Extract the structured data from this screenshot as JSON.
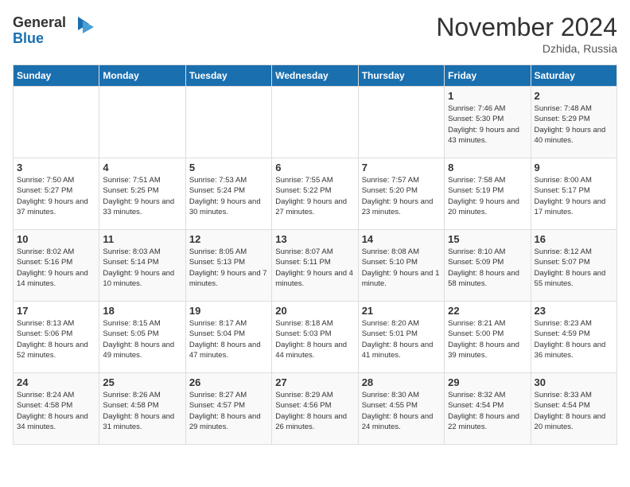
{
  "logo": {
    "line1": "General",
    "line2": "Blue"
  },
  "title": "November 2024",
  "location": "Dzhida, Russia",
  "days_header": [
    "Sunday",
    "Monday",
    "Tuesday",
    "Wednesday",
    "Thursday",
    "Friday",
    "Saturday"
  ],
  "weeks": [
    [
      {
        "day": "",
        "info": ""
      },
      {
        "day": "",
        "info": ""
      },
      {
        "day": "",
        "info": ""
      },
      {
        "day": "",
        "info": ""
      },
      {
        "day": "",
        "info": ""
      },
      {
        "day": "1",
        "info": "Sunrise: 7:46 AM\nSunset: 5:30 PM\nDaylight: 9 hours and 43 minutes."
      },
      {
        "day": "2",
        "info": "Sunrise: 7:48 AM\nSunset: 5:29 PM\nDaylight: 9 hours and 40 minutes."
      }
    ],
    [
      {
        "day": "3",
        "info": "Sunrise: 7:50 AM\nSunset: 5:27 PM\nDaylight: 9 hours and 37 minutes."
      },
      {
        "day": "4",
        "info": "Sunrise: 7:51 AM\nSunset: 5:25 PM\nDaylight: 9 hours and 33 minutes."
      },
      {
        "day": "5",
        "info": "Sunrise: 7:53 AM\nSunset: 5:24 PM\nDaylight: 9 hours and 30 minutes."
      },
      {
        "day": "6",
        "info": "Sunrise: 7:55 AM\nSunset: 5:22 PM\nDaylight: 9 hours and 27 minutes."
      },
      {
        "day": "7",
        "info": "Sunrise: 7:57 AM\nSunset: 5:20 PM\nDaylight: 9 hours and 23 minutes."
      },
      {
        "day": "8",
        "info": "Sunrise: 7:58 AM\nSunset: 5:19 PM\nDaylight: 9 hours and 20 minutes."
      },
      {
        "day": "9",
        "info": "Sunrise: 8:00 AM\nSunset: 5:17 PM\nDaylight: 9 hours and 17 minutes."
      }
    ],
    [
      {
        "day": "10",
        "info": "Sunrise: 8:02 AM\nSunset: 5:16 PM\nDaylight: 9 hours and 14 minutes."
      },
      {
        "day": "11",
        "info": "Sunrise: 8:03 AM\nSunset: 5:14 PM\nDaylight: 9 hours and 10 minutes."
      },
      {
        "day": "12",
        "info": "Sunrise: 8:05 AM\nSunset: 5:13 PM\nDaylight: 9 hours and 7 minutes."
      },
      {
        "day": "13",
        "info": "Sunrise: 8:07 AM\nSunset: 5:11 PM\nDaylight: 9 hours and 4 minutes."
      },
      {
        "day": "14",
        "info": "Sunrise: 8:08 AM\nSunset: 5:10 PM\nDaylight: 9 hours and 1 minute."
      },
      {
        "day": "15",
        "info": "Sunrise: 8:10 AM\nSunset: 5:09 PM\nDaylight: 8 hours and 58 minutes."
      },
      {
        "day": "16",
        "info": "Sunrise: 8:12 AM\nSunset: 5:07 PM\nDaylight: 8 hours and 55 minutes."
      }
    ],
    [
      {
        "day": "17",
        "info": "Sunrise: 8:13 AM\nSunset: 5:06 PM\nDaylight: 8 hours and 52 minutes."
      },
      {
        "day": "18",
        "info": "Sunrise: 8:15 AM\nSunset: 5:05 PM\nDaylight: 8 hours and 49 minutes."
      },
      {
        "day": "19",
        "info": "Sunrise: 8:17 AM\nSunset: 5:04 PM\nDaylight: 8 hours and 47 minutes."
      },
      {
        "day": "20",
        "info": "Sunrise: 8:18 AM\nSunset: 5:03 PM\nDaylight: 8 hours and 44 minutes."
      },
      {
        "day": "21",
        "info": "Sunrise: 8:20 AM\nSunset: 5:01 PM\nDaylight: 8 hours and 41 minutes."
      },
      {
        "day": "22",
        "info": "Sunrise: 8:21 AM\nSunset: 5:00 PM\nDaylight: 8 hours and 39 minutes."
      },
      {
        "day": "23",
        "info": "Sunrise: 8:23 AM\nSunset: 4:59 PM\nDaylight: 8 hours and 36 minutes."
      }
    ],
    [
      {
        "day": "24",
        "info": "Sunrise: 8:24 AM\nSunset: 4:58 PM\nDaylight: 8 hours and 34 minutes."
      },
      {
        "day": "25",
        "info": "Sunrise: 8:26 AM\nSunset: 4:58 PM\nDaylight: 8 hours and 31 minutes."
      },
      {
        "day": "26",
        "info": "Sunrise: 8:27 AM\nSunset: 4:57 PM\nDaylight: 8 hours and 29 minutes."
      },
      {
        "day": "27",
        "info": "Sunrise: 8:29 AM\nSunset: 4:56 PM\nDaylight: 8 hours and 26 minutes."
      },
      {
        "day": "28",
        "info": "Sunrise: 8:30 AM\nSunset: 4:55 PM\nDaylight: 8 hours and 24 minutes."
      },
      {
        "day": "29",
        "info": "Sunrise: 8:32 AM\nSunset: 4:54 PM\nDaylight: 8 hours and 22 minutes."
      },
      {
        "day": "30",
        "info": "Sunrise: 8:33 AM\nSunset: 4:54 PM\nDaylight: 8 hours and 20 minutes."
      }
    ]
  ]
}
